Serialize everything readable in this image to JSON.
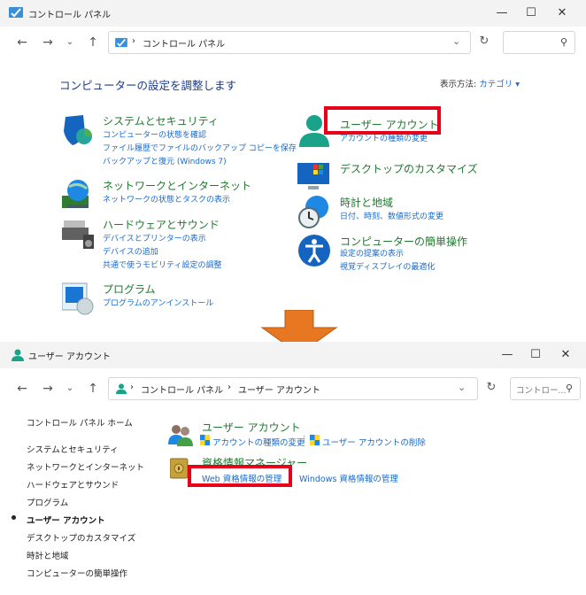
{
  "window1": {
    "title": "コントロール パネル",
    "breadcrumb": "コントロール パネル",
    "heading": "コンピューターの設定を調整します",
    "view_by_label": "表示方法:",
    "view_by_value": "カテゴリ ▾",
    "categories_left": [
      {
        "title": "システムとセキュリティ",
        "links": [
          "コンピューターの状態を確認",
          "ファイル履歴でファイルのバックアップ コピーを保存",
          "バックアップと復元 (Windows 7)"
        ]
      },
      {
        "title": "ネットワークとインターネット",
        "links": [
          "ネットワークの状態とタスクの表示"
        ]
      },
      {
        "title": "ハードウェアとサウンド",
        "links": [
          "デバイスとプリンターの表示",
          "デバイスの追加",
          "共通で使うモビリティ設定の調整"
        ]
      },
      {
        "title": "プログラム",
        "links": [
          "プログラムのアンインストール"
        ]
      }
    ],
    "categories_right": [
      {
        "title": "ユーザー アカウント",
        "links": [
          "アカウントの種類の変更"
        ]
      },
      {
        "title": "デスクトップのカスタマイズ",
        "links": []
      },
      {
        "title": "時計と地域",
        "links": [
          "日付、時刻、数値形式の変更"
        ]
      },
      {
        "title": "コンピューターの簡単操作",
        "links": [
          "設定の提案の表示",
          "視覚ディスプレイの最適化"
        ]
      }
    ]
  },
  "window2": {
    "title": "ユーザー アカウント",
    "breadcrumb1": "コントロール パネル",
    "breadcrumb2": "ユーザー アカウント",
    "search_placeholder": "コントロー...",
    "sidebar": [
      {
        "label": "コントロール パネル ホーム"
      },
      {
        "label": "システムとセキュリティ"
      },
      {
        "label": "ネットワークとインターネット"
      },
      {
        "label": "ハードウェアとサウンド"
      },
      {
        "label": "プログラム"
      },
      {
        "label": "ユーザー アカウント"
      },
      {
        "label": "デスクトップのカスタマイズ"
      },
      {
        "label": "時計と地域"
      },
      {
        "label": "コンピューターの簡単操作"
      }
    ],
    "user_accounts": {
      "title": "ユーザー アカウント",
      "link1": "アカウントの種類の変更",
      "link2": "ユーザー アカウントの削除"
    },
    "credential_manager": {
      "title": "資格情報マネージャー",
      "link1": "Web 資格情報の管理",
      "link2": "Windows 資格情報の管理"
    }
  },
  "colors": {
    "highlight": "#e6001a",
    "arrow": "#e87722",
    "link": "#1a6ac9",
    "category": "#1e7a2e"
  }
}
